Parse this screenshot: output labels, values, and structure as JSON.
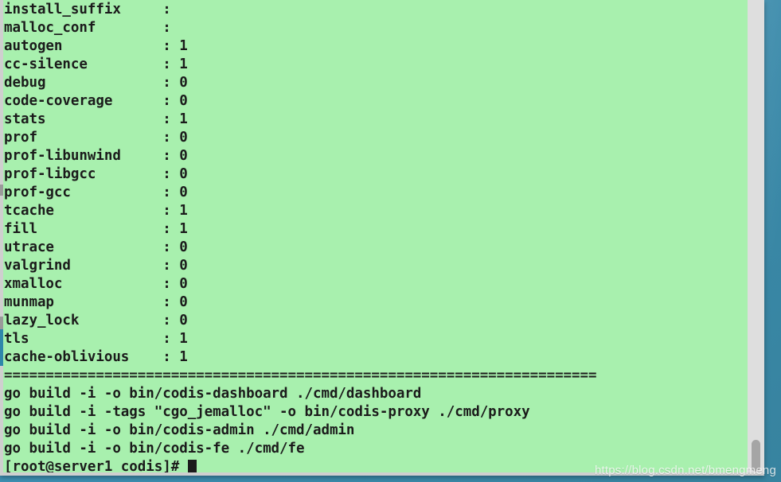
{
  "window": {
    "title": "[root@server1 codis]",
    "background_color": "#a8f0ae",
    "text_color": "#1b1b1b",
    "desktop_color": "#3e93b5"
  },
  "terminal": {
    "config_rows": [
      {
        "key": "install_suffix",
        "sep": ":",
        "value": ""
      },
      {
        "key": "malloc_conf",
        "sep": ":",
        "value": ""
      },
      {
        "key": "autogen",
        "sep": ":",
        "value": "1"
      },
      {
        "key": "cc-silence",
        "sep": ":",
        "value": "1"
      },
      {
        "key": "debug",
        "sep": ":",
        "value": "0"
      },
      {
        "key": "code-coverage",
        "sep": ":",
        "value": "0"
      },
      {
        "key": "stats",
        "sep": ":",
        "value": "1"
      },
      {
        "key": "prof",
        "sep": ":",
        "value": "0"
      },
      {
        "key": "prof-libunwind",
        "sep": ":",
        "value": "0"
      },
      {
        "key": "prof-libgcc",
        "sep": ":",
        "value": "0"
      },
      {
        "key": "prof-gcc",
        "sep": ":",
        "value": "0"
      },
      {
        "key": "tcache",
        "sep": ":",
        "value": "1"
      },
      {
        "key": "fill",
        "sep": ":",
        "value": "1"
      },
      {
        "key": "utrace",
        "sep": ":",
        "value": "0"
      },
      {
        "key": "valgrind",
        "sep": ":",
        "value": "0"
      },
      {
        "key": "xmalloc",
        "sep": ":",
        "value": "0"
      },
      {
        "key": "munmap",
        "sep": ":",
        "value": "0"
      },
      {
        "key": "lazy_lock",
        "sep": ":",
        "value": "0"
      },
      {
        "key": "tls",
        "sep": ":",
        "value": "1"
      },
      {
        "key": "cache-oblivious",
        "sep": ":",
        "value": "1"
      }
    ],
    "separator_char": "=",
    "separator_length": 71,
    "build_lines": [
      "go build -i -o bin/codis-dashboard ./cmd/dashboard",
      "go build -i -tags \"cgo_jemalloc\" -o bin/codis-proxy ./cmd/proxy",
      "go build -i -o bin/codis-admin ./cmd/admin",
      "go build -i -o bin/codis-fe ./cmd/fe"
    ],
    "prompt": "[root@server1 codis]# ",
    "key_column_width": 19,
    "value_column_gap": " "
  },
  "scrollbar": {
    "orientation": "vertical",
    "thumb_position_pct": 93
  },
  "watermark": {
    "text": "https://blog.csdn.net/bmengmeng"
  }
}
